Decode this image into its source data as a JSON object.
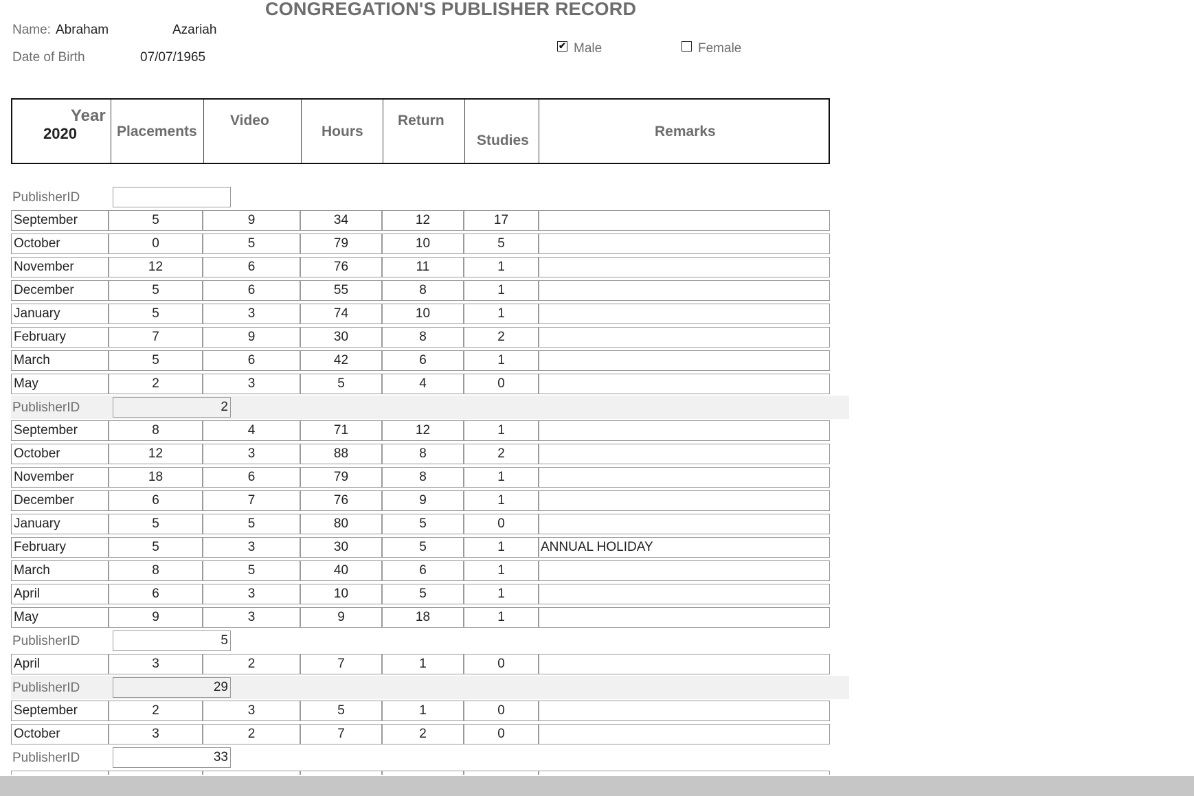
{
  "title": "CONGREGATION'S PUBLISHER RECORD",
  "name_label": "Name:",
  "first_name": "Abraham",
  "last_name": "Azariah",
  "dob_label": "Date of Birth",
  "dob_value": "07/07/1965",
  "gender": {
    "male_label": "Male",
    "female_label": "Female",
    "male_checked": true,
    "female_checked": false
  },
  "header": {
    "year_label": "Year",
    "year_value": "2020",
    "placements": "Placements",
    "video": "Video",
    "hours": "Hours",
    "return": "Return",
    "studies": "Studies",
    "remarks": "Remarks"
  },
  "publisher_label": "PublisherID",
  "groups": [
    {
      "publisher_id": "",
      "rows": [
        {
          "month": "September",
          "placements": "5",
          "video": "9",
          "hours": "34",
          "return": "12",
          "studies": "17",
          "remarks": ""
        },
        {
          "month": "October",
          "placements": "0",
          "video": "5",
          "hours": "79",
          "return": "10",
          "studies": "5",
          "remarks": ""
        },
        {
          "month": "November",
          "placements": "12",
          "video": "6",
          "hours": "76",
          "return": "11",
          "studies": "1",
          "remarks": ""
        },
        {
          "month": "December",
          "placements": "5",
          "video": "6",
          "hours": "55",
          "return": "8",
          "studies": "1",
          "remarks": ""
        },
        {
          "month": "January",
          "placements": "5",
          "video": "3",
          "hours": "74",
          "return": "10",
          "studies": "1",
          "remarks": ""
        },
        {
          "month": "February",
          "placements": "7",
          "video": "9",
          "hours": "30",
          "return": "8",
          "studies": "2",
          "remarks": ""
        },
        {
          "month": "March",
          "placements": "5",
          "video": "6",
          "hours": "42",
          "return": "6",
          "studies": "1",
          "remarks": ""
        },
        {
          "month": "May",
          "placements": "2",
          "video": "3",
          "hours": "5",
          "return": "4",
          "studies": "0",
          "remarks": ""
        }
      ]
    },
    {
      "publisher_id": "2",
      "rows": [
        {
          "month": "September",
          "placements": "8",
          "video": "4",
          "hours": "71",
          "return": "12",
          "studies": "1",
          "remarks": ""
        },
        {
          "month": "October",
          "placements": "12",
          "video": "3",
          "hours": "88",
          "return": "8",
          "studies": "2",
          "remarks": ""
        },
        {
          "month": "November",
          "placements": "18",
          "video": "6",
          "hours": "79",
          "return": "8",
          "studies": "1",
          "remarks": ""
        },
        {
          "month": "December",
          "placements": "6",
          "video": "7",
          "hours": "76",
          "return": "9",
          "studies": "1",
          "remarks": ""
        },
        {
          "month": "January",
          "placements": "5",
          "video": "5",
          "hours": "80",
          "return": "5",
          "studies": "0",
          "remarks": ""
        },
        {
          "month": "February",
          "placements": "5",
          "video": "3",
          "hours": "30",
          "return": "5",
          "studies": "1",
          "remarks": "ANNUAL HOLIDAY"
        },
        {
          "month": "March",
          "placements": "8",
          "video": "5",
          "hours": "40",
          "return": "6",
          "studies": "1",
          "remarks": ""
        },
        {
          "month": "April",
          "placements": "6",
          "video": "3",
          "hours": "10",
          "return": "5",
          "studies": "1",
          "remarks": ""
        },
        {
          "month": "May",
          "placements": "9",
          "video": "3",
          "hours": "9",
          "return": "18",
          "studies": "1",
          "remarks": ""
        }
      ]
    },
    {
      "publisher_id": "5",
      "rows": [
        {
          "month": "April",
          "placements": "3",
          "video": "2",
          "hours": "7",
          "return": "1",
          "studies": "0",
          "remarks": ""
        }
      ]
    },
    {
      "publisher_id": "29",
      "rows": [
        {
          "month": "September",
          "placements": "2",
          "video": "3",
          "hours": "5",
          "return": "1",
          "studies": "0",
          "remarks": ""
        },
        {
          "month": "October",
          "placements": "3",
          "video": "2",
          "hours": "7",
          "return": "2",
          "studies": "0",
          "remarks": ""
        }
      ]
    },
    {
      "publisher_id": "33",
      "rows": []
    }
  ]
}
